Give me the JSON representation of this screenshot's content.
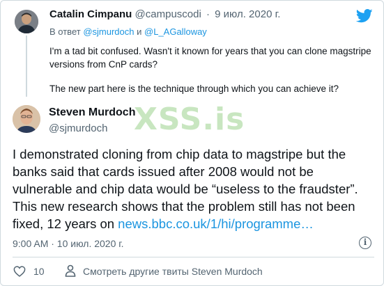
{
  "reply_tweet": {
    "author_name": "Catalin Cimpanu",
    "author_handle": "@campuscodi",
    "separator": "·",
    "date": "9 июл. 2020 г.",
    "reply_prefix": "В ответ",
    "reply_handle_1": "@sjmurdoch",
    "reply_conj": "и",
    "reply_handle_2": "@L_AGalloway",
    "text_p1": "I'm a tad bit confused. Wasn't it known for years that you can clone magstripe versions from CnP cards?",
    "text_p2": "The new part here is the technique through which you can achieve it?"
  },
  "main_tweet": {
    "author_name": "Steven Murdoch",
    "author_handle": "@sjmurdoch",
    "text": "I demonstrated cloning from chip data to magstripe but the banks said that cards issued after 2008 would not be vulnerable and chip data would be “useless to the fraudster”. This new research shows that the problem still has not been fixed, 12 years on ",
    "link_text": "news.bbc.co.uk/1/hi/programme…",
    "timestamp": "9:00 AM · 10 июл. 2020 г.",
    "info_glyph": "i",
    "like_count": "10",
    "more_tweets_label": "Смотреть другие твиты Steven Murdoch"
  },
  "watermark": "XSS.is",
  "icons": {
    "brand": "twitter-bird-icon",
    "info": "info-icon",
    "like": "heart-icon",
    "profile": "person-icon"
  },
  "colors": {
    "link": "#1b95e0",
    "twitter_blue": "#1da1f2",
    "secondary_text": "#536471",
    "watermark": "#c8e6c0"
  }
}
